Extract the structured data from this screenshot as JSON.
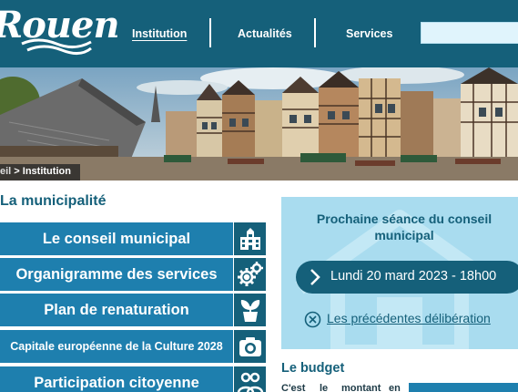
{
  "header": {
    "logo_text": "Rouen",
    "nav": [
      {
        "label": "Institution",
        "active": true
      },
      {
        "label": "Actualités",
        "active": false
      },
      {
        "label": "Services",
        "active": false
      }
    ],
    "colors": {
      "header": "#15607a",
      "accent": "#1e7fae",
      "light": "#a9dcef"
    }
  },
  "breadcrumb": {
    "home": "eil",
    "separator": " > ",
    "current": "Institution"
  },
  "main": {
    "section_title": "La municipalité",
    "menu": [
      {
        "label": "Le conseil municipal",
        "icon": "city-hall-icon"
      },
      {
        "label": "Organigramme des services",
        "icon": "gears-icon"
      },
      {
        "label": "Plan de renaturation",
        "icon": "plant-pot-icon"
      },
      {
        "label": "Capitale européenne de la Culture 2028",
        "icon": "camera-icon"
      },
      {
        "label": "Participation citoyenne",
        "icon": "people-icon"
      }
    ]
  },
  "sidebar": {
    "seance_title": "Prochaine séance du conseil municipal",
    "seance_date": "Lundi 20 mard 2023 - 18h00",
    "previous_link": "Les précédentes délibération",
    "budget_title": "Le budget",
    "budget_text_words": [
      "C'est",
      "le",
      "montant",
      "en"
    ]
  }
}
